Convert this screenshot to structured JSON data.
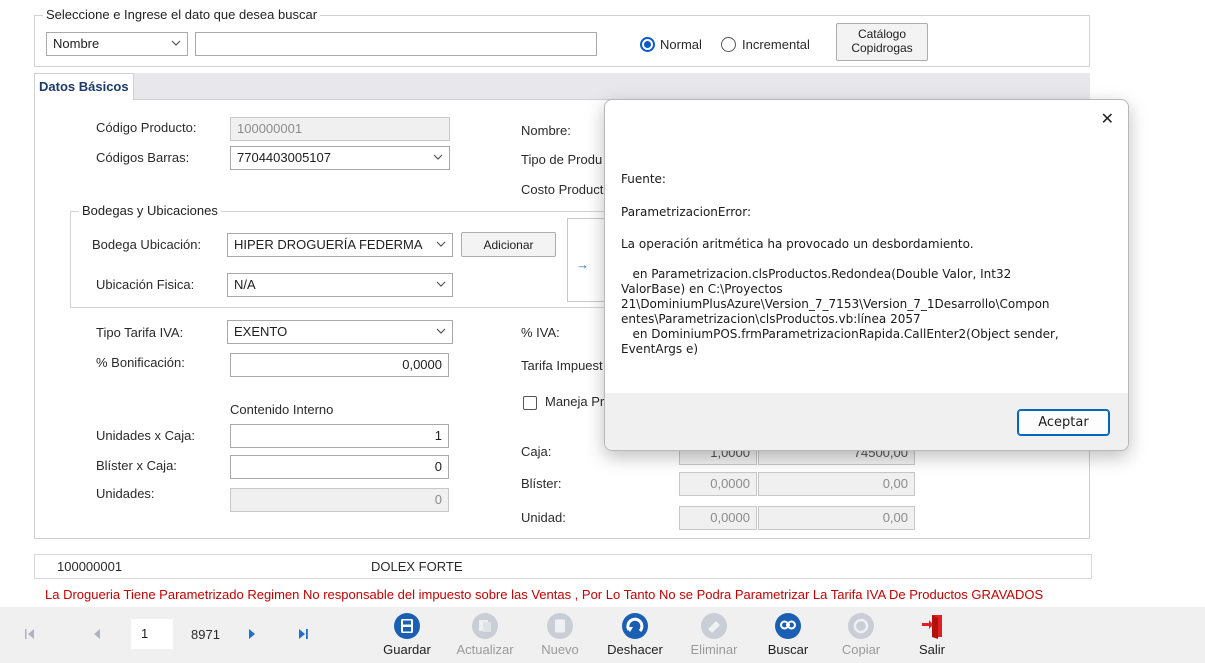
{
  "search": {
    "legend": "Seleccione e Ingrese el dato que desea buscar",
    "field_value": "Nombre",
    "query_value": "",
    "mode_normal": "Normal",
    "mode_incremental": "Incremental",
    "mode_selected": "Normal",
    "catalog_line1": "Catálogo",
    "catalog_line2": "Copidrogas"
  },
  "tab": {
    "label": "Datos Básicos"
  },
  "form": {
    "codigo_label": "Código Producto:",
    "codigo_value": "100000001",
    "barras_label": "Códigos Barras:",
    "barras_value": "7704403005107",
    "nombre_label": "Nombre:",
    "tipo_label": "Tipo de Produ",
    "costo_label": "Costo Product",
    "bodegas_legend": "Bodegas y Ubicaciones",
    "bodega_label": "Bodega Ubicación:",
    "bodega_value": "HIPER DROGUERÍA FEDERMA",
    "adicionar": "Adicionar",
    "ubicacion_label": "Ubicación Fisica:",
    "ubicacion_value": "N/A",
    "tarifa_label": "Tipo Tarifa IVA:",
    "tarifa_value": "EXENTO",
    "iva_label": "% IVA:",
    "bonif_label": "% Bonificación:",
    "bonif_value": "0,0000",
    "tarifa_imp_label": "Tarifa Impuest",
    "maneja_label": "Maneja Pr",
    "contenido_label": "Contenido Interno",
    "unidades_caja_label": "Unidades x Caja:",
    "unidades_caja_value": "1",
    "blister_caja_label": "Blíster x Caja:",
    "blister_caja_value": "0",
    "unidades_label": "Unidades:",
    "unidades_value": "0",
    "caja_label": "Caja:",
    "caja_v1": "1,0000",
    "caja_v2": "74500,00",
    "blister_label": "Blíster:",
    "blister_v1": "0,0000",
    "blister_v2": "0,00",
    "unidad_label": "Unidad:",
    "unidad_v1": "0,0000",
    "unidad_v2": "0,00"
  },
  "info": {
    "code": "100000001",
    "name": "DOLEX FORTE"
  },
  "message": "La Drogueria Tiene Parametrizado Regimen No responsable del impuesto sobre las Ventas , Por Lo Tanto No se Podra Parametrizar La Tarifa IVA De Productos GRAVADOS",
  "nav": {
    "position": "1",
    "total": "8971"
  },
  "toolbar": {
    "guardar": "Guardar",
    "actualizar": "Actualizar",
    "nuevo": "Nuevo",
    "deshacer": "Deshacer",
    "eliminar": "Eliminar",
    "buscar": "Buscar",
    "copiar": "Copiar",
    "salir": "Salir"
  },
  "dialog": {
    "fuente": "Fuente:",
    "error_name": "ParametrizacionError:",
    "message": "La operación aritmética ha provocado un desbordamiento.",
    "stack": "   en Parametrizacion.clsProductos.Redondea(Double Valor, Int32\nValorBase) en C:\\Proyectos\n21\\DominiumPlusAzure\\Version_7_7153\\Version_7_1Desarrollo\\Compon\nentes\\Parametrizacion\\clsProductos.vb:línea 2057\n   en DominiumPOS.frmParametrizacionRapida.CallEnter2(Object sender,\nEventArgs e)",
    "accept": "Aceptar",
    "close_symbol": "✕"
  },
  "colors": {
    "accent": "#0a5ac8",
    "error_text": "#c80000",
    "dialog_button_border": "#0067c0"
  }
}
